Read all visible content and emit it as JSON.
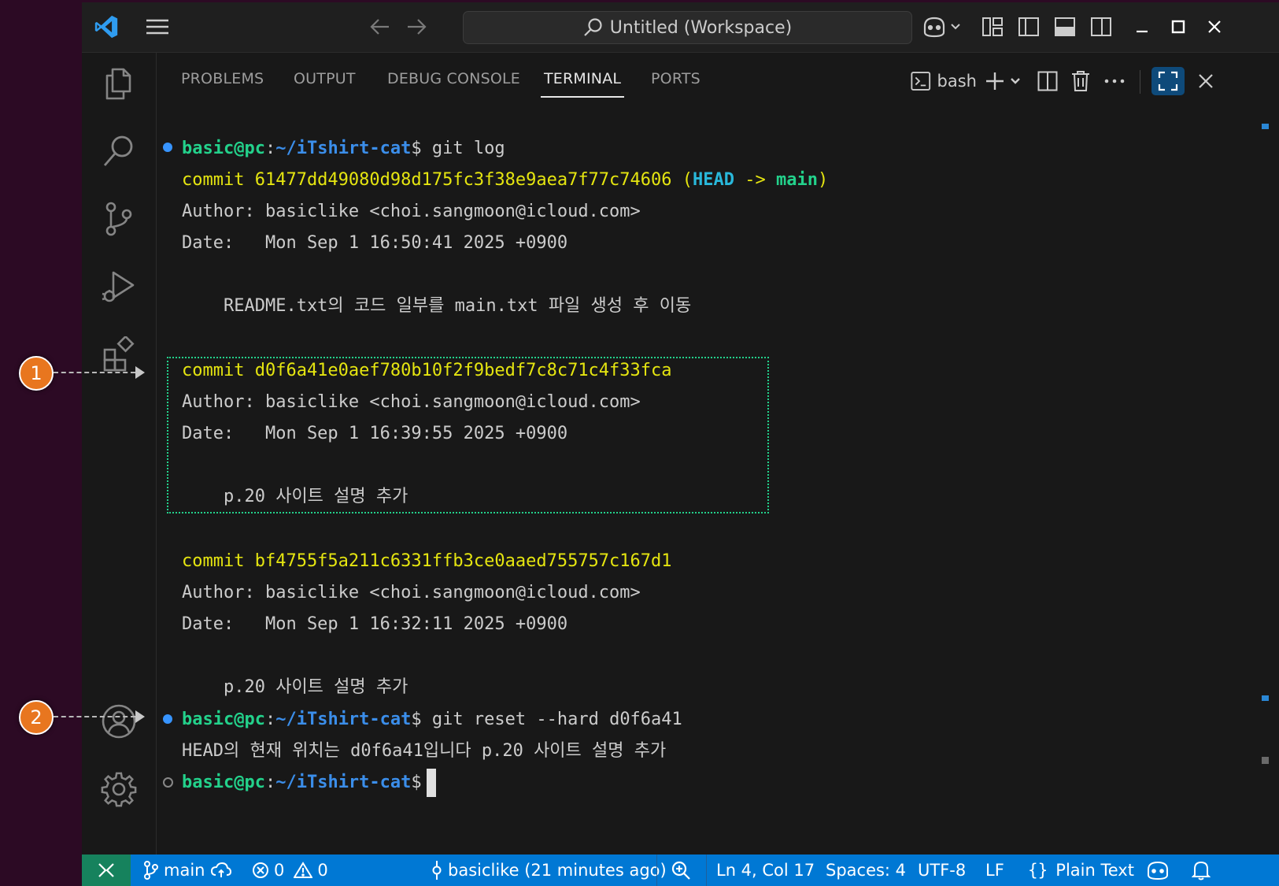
{
  "titlebar": {
    "search_text": "Untitled (Workspace)"
  },
  "panel": {
    "tabs": [
      "PROBLEMS",
      "OUTPUT",
      "DEBUG CONSOLE",
      "TERMINAL",
      "PORTS"
    ],
    "active_tab": "TERMINAL",
    "terminal_profile": "bash"
  },
  "terminal": {
    "prompt_user": "basic@pc",
    "prompt_colon": ":",
    "prompt_path": "~/iTshirt-cat",
    "prompt_dollar": "$",
    "cmd1": " git log",
    "commit1": {
      "hash_line": "commit 61477dd49080d98d175fc3f38e9aea7f77c74606 ",
      "paren_open": "(",
      "head": "HEAD",
      "arrow": " -> ",
      "branch": "main",
      "paren_close": ")",
      "author": "Author: basiclike <choi.sangmoon@icloud.com>",
      "date": "Date:   Mon Sep 1 16:50:41 2025 +0900",
      "message": "    README.txt의 코드 일부를 main.txt 파일 생성 후 이동"
    },
    "commit2": {
      "hash_line": "commit d0f6a41e0aef780b10f2f9bedf7c8c71c4f33fca",
      "author": "Author: basiclike <choi.sangmoon@icloud.com>",
      "date": "Date:   Mon Sep 1 16:39:55 2025 +0900",
      "message": "    p.20 사이트 설명 추가"
    },
    "commit3": {
      "hash_line": "commit bf4755f5a211c6331ffb3ce0aaed755757c167d1",
      "author": "Author: basiclike <choi.sangmoon@icloud.com>",
      "date": "Date:   Mon Sep 1 16:32:11 2025 +0900",
      "message": "    p.20 사이트 설명 추가"
    },
    "cmd2": " git reset --hard d0f6a41",
    "reset_output": "HEAD의 현재 위치는 d0f6a41입니다 p.20 사이트 설명 추가"
  },
  "statusbar": {
    "branch": "main",
    "errors": "0",
    "warnings": "0",
    "blame": "basiclike (21 minutes ago)",
    "cursor_position": "Ln 4, Col 17",
    "indentation": "Spaces: 4",
    "encoding": "UTF-8",
    "eol": "LF",
    "language": "Plain Text"
  },
  "annotations": [
    "1",
    "2"
  ],
  "colors": {
    "accent": "#0078d4",
    "annotation": "#e8761f",
    "highlight_border": "#23d18b"
  }
}
